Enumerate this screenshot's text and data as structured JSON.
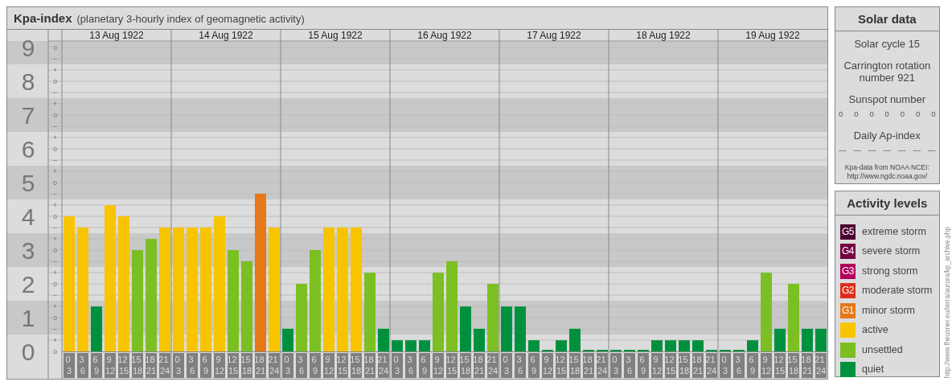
{
  "header": {
    "title": "Kpa-index",
    "subtitle": "(planetary 3-hourly index of geomagnetic activity)"
  },
  "scale_marks": [
    {
      "marks": [
        "o",
        "–"
      ]
    },
    {
      "marks": [
        "+",
        "o",
        "–"
      ]
    },
    {
      "marks": [
        "+",
        "o",
        "–"
      ]
    },
    {
      "marks": [
        "+",
        "o",
        "–"
      ]
    },
    {
      "marks": [
        "+",
        "o",
        "–"
      ]
    },
    {
      "marks": [
        "+",
        "o",
        "–"
      ]
    },
    {
      "marks": [
        "+",
        "o",
        "–"
      ]
    },
    {
      "marks": [
        "+",
        "o",
        "–"
      ]
    },
    {
      "marks": [
        "+",
        "o",
        "–"
      ]
    },
    {
      "marks": [
        "+",
        "o"
      ]
    }
  ],
  "days": [
    {
      "date": "13 Aug 1922"
    },
    {
      "date": "14 Aug 1922"
    },
    {
      "date": "15 Aug 1922"
    },
    {
      "date": "16 Aug 1922"
    },
    {
      "date": "17 Aug 1922"
    },
    {
      "date": "18 Aug 1922"
    },
    {
      "date": "19 Aug 1922"
    }
  ],
  "chart_data": {
    "type": "bar",
    "grid": true,
    "ylim": [
      0,
      9
    ],
    "yticks": [
      {
        "value": 9,
        "label": "9"
      },
      {
        "value": 8,
        "label": "8"
      },
      {
        "value": 7,
        "label": "7"
      },
      {
        "value": 6,
        "label": "6"
      },
      {
        "value": 5,
        "label": "5"
      },
      {
        "value": 4,
        "label": "4"
      },
      {
        "value": 3,
        "label": "3"
      },
      {
        "value": 2,
        "label": "2"
      },
      {
        "value": 1,
        "label": "1"
      },
      {
        "value": 0,
        "label": "0"
      }
    ],
    "categories": [
      "0 3",
      "3 6",
      "6 9",
      "9 12",
      "12 15",
      "15 18",
      "18 21",
      "21 24",
      "0 3",
      "3 6",
      "6 9",
      "9 12",
      "12 15",
      "15 18",
      "18 21",
      "21 24",
      "0 3",
      "3 6",
      "6 9",
      "9 12",
      "12 15",
      "15 18",
      "18 21",
      "21 24",
      "0 3",
      "3 6",
      "6 9",
      "9 12",
      "12 15",
      "15 18",
      "18 21",
      "21 24",
      "0 3",
      "3 6",
      "6 9",
      "9 12",
      "12 15",
      "15 18",
      "18 21",
      "21 24",
      "0 3",
      "3 6",
      "6 9",
      "9 12",
      "12 15",
      "15 18",
      "18 21",
      "21 24",
      "0 3",
      "3 6",
      "6 9",
      "9 12",
      "12 15",
      "15 18",
      "18 21",
      "21 24"
    ],
    "series": [
      {
        "color": "#00913f",
        "values": [
          null,
          null,
          1.33,
          null,
          null,
          null,
          null,
          null,
          null,
          null,
          null,
          null,
          null,
          null,
          null,
          null,
          0.67,
          null,
          null,
          null,
          null,
          null,
          null,
          0.67,
          0.33,
          0.33,
          0.33,
          null,
          null,
          1.33,
          0.67,
          null,
          1.33,
          1.33,
          0.33,
          0,
          0.33,
          0.67,
          0,
          0,
          0,
          0,
          0,
          0.33,
          0.33,
          0.33,
          0.33,
          0,
          0,
          0,
          0.33,
          null,
          0.67,
          null,
          0.67,
          0.67
        ]
      },
      {
        "color": "#7bbf22",
        "values": [
          null,
          null,
          null,
          null,
          null,
          3,
          3.33,
          null,
          null,
          null,
          null,
          null,
          3,
          2.67,
          null,
          null,
          null,
          2,
          3,
          null,
          null,
          null,
          2.33,
          null,
          null,
          null,
          null,
          2.33,
          2.67,
          null,
          null,
          2,
          null,
          null,
          null,
          null,
          null,
          null,
          null,
          null,
          null,
          null,
          null,
          null,
          null,
          null,
          null,
          null,
          null,
          null,
          null,
          2.33,
          null,
          2,
          null,
          null
        ]
      },
      {
        "color": "#f8c400",
        "values": [
          4,
          3.67,
          null,
          4.33,
          4,
          null,
          null,
          3.67,
          3.67,
          3.67,
          3.67,
          4,
          null,
          null,
          null,
          3.67,
          null,
          null,
          null,
          3.67,
          3.67,
          3.67,
          null,
          null,
          null,
          null,
          null,
          null,
          null,
          null,
          null,
          null,
          null,
          null,
          null,
          null,
          null,
          null,
          null,
          null,
          null,
          null,
          null,
          null,
          null,
          null,
          null,
          null,
          null,
          null,
          null,
          null,
          null,
          null,
          null,
          null
        ]
      },
      {
        "color": "#e67817",
        "values": [
          null,
          null,
          null,
          null,
          null,
          null,
          null,
          null,
          null,
          null,
          null,
          null,
          null,
          null,
          4.67,
          null,
          null,
          null,
          null,
          null,
          null,
          null,
          null,
          null,
          null,
          null,
          null,
          null,
          null,
          null,
          null,
          null,
          null,
          null,
          null,
          null,
          null,
          null,
          null,
          null,
          null,
          null,
          null,
          null,
          null,
          null,
          null,
          null,
          null,
          null,
          null,
          null,
          null,
          null,
          null,
          null
        ]
      }
    ]
  },
  "solar_data": {
    "title": "Solar data",
    "cycle": "Solar cycle 15",
    "rotation": "Carrington rotation number 921",
    "sunspot_label": "Sunspot number",
    "sunspots": [
      "0",
      "0",
      "0",
      "0",
      "0",
      "0",
      "0"
    ],
    "ap_label": "Daily Ap-index",
    "ap": [
      "—",
      "—",
      "—",
      "—",
      "—",
      "—",
      "—"
    ],
    "source": "Kpa-data from NOAA NCEI:",
    "source_link": "http://www.ngdc.noaa.gov/"
  },
  "activity_levels": {
    "title": "Activity levels",
    "items": [
      {
        "badge": "G5",
        "label": "extreme storm",
        "color": "#4b0030"
      },
      {
        "badge": "G4",
        "label": "severe storm",
        "color": "#730042"
      },
      {
        "badge": "G3",
        "label": "strong storm",
        "color": "#b0005e"
      },
      {
        "badge": "G2",
        "label": "moderate storm",
        "color": "#dc2e1c"
      },
      {
        "badge": "G1",
        "label": "minor storm",
        "color": "#e67817"
      },
      {
        "label": "active",
        "color": "#f8c400"
      },
      {
        "label": "unsettled",
        "color": "#7bbf22"
      },
      {
        "label": "quiet",
        "color": "#00913f"
      }
    ]
  },
  "source_url": "http://www.fheusner.eu/terra/aurora/kp_archive.php"
}
